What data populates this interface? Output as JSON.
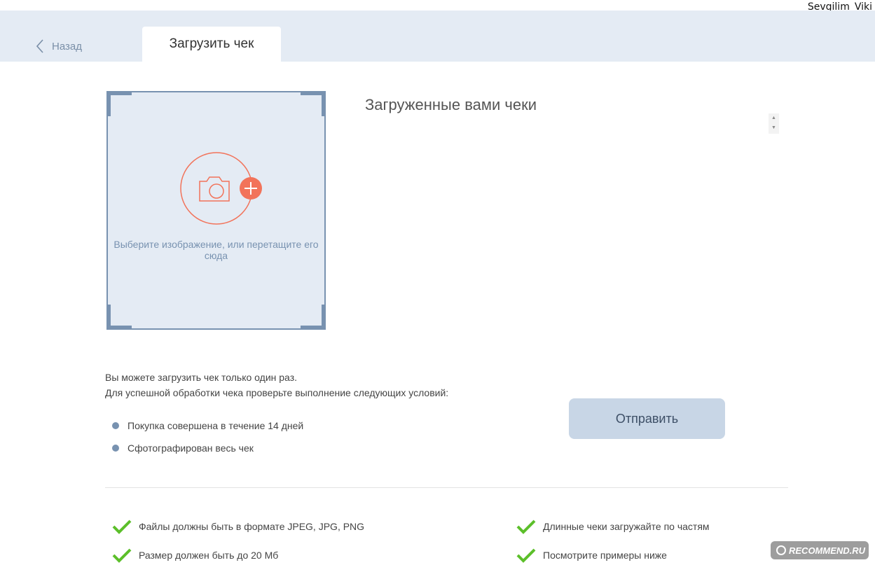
{
  "user": {
    "name": "Sevgilim_Viki"
  },
  "nav": {
    "back_label": "Назад",
    "active_tab": "Загрузить чек"
  },
  "upload": {
    "prompt": "Выберите изображение, или перетащите его сюда"
  },
  "uploaded": {
    "title": "Загруженные вами чеки"
  },
  "info": {
    "line1": "Вы можете загрузить чек только один раз.",
    "line2": "Для успешной обработки чека проверьте выполнение следующих условий:",
    "conditions": [
      "Покупка совершена в течение 14 дней",
      "Сфотографирован весь чек"
    ]
  },
  "actions": {
    "send_label": "Отправить"
  },
  "requirements": [
    "Файлы должны быть в формате JPEG, JPG, PNG",
    "Размер должен быть до 20 Мб",
    "Длинные чеки загружайте по частям",
    "Посмотрите примеры ниже"
  ],
  "watermark": {
    "text": "RECOMMEND.RU"
  },
  "colors": {
    "accent": "#f2735a",
    "frame": "#7892b0",
    "check": "#5cbf2a",
    "header_bg": "#e4ebf4",
    "button_bg": "#c8d6e6"
  }
}
